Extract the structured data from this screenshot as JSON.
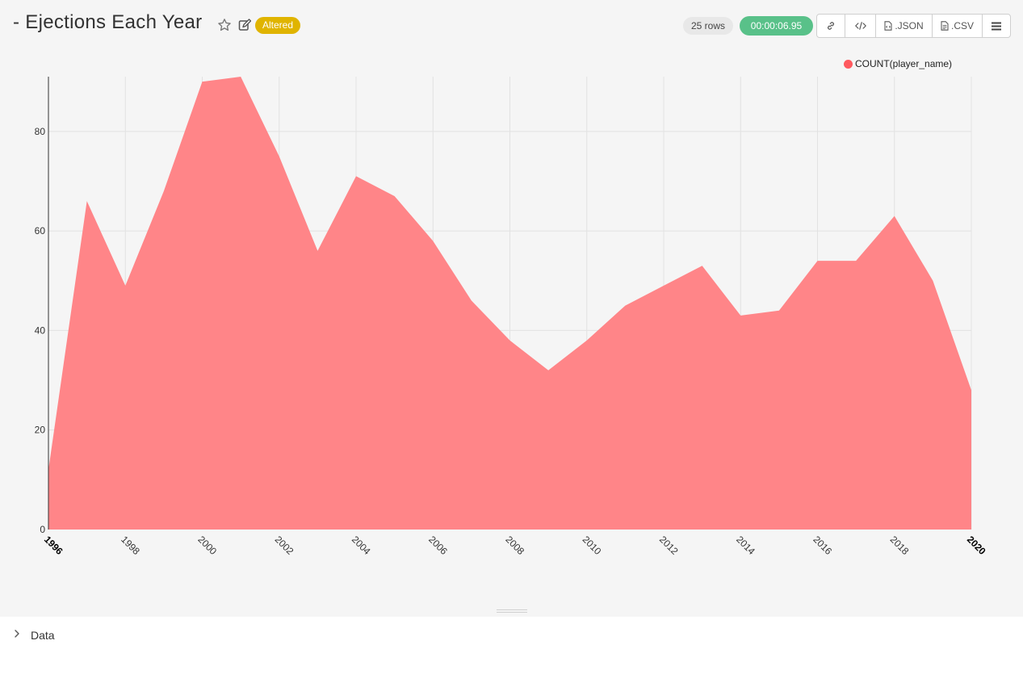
{
  "header": {
    "title": "- Ejections Each Year",
    "altered_badge": "Altered",
    "rows_badge": "25 rows",
    "timer": "00:00:06.95",
    "json_label": ".JSON",
    "csv_label": ".CSV"
  },
  "icons": {
    "favorite": "star-icon",
    "edit": "edit-icon",
    "share_link": "link-icon",
    "embed_code": "code-icon",
    "json_file": "file-code-icon",
    "csv_file": "file-text-icon",
    "menu": "menu-icon",
    "data_toggle": "chevron-right-icon"
  },
  "colors": {
    "area": "#ff8588",
    "legend_dot": "#ff5a5f",
    "altered": "#e0b400",
    "timer": "#59c189"
  },
  "data_panel": {
    "label": "Data"
  },
  "chart_data": {
    "type": "area",
    "series": [
      {
        "name": "COUNT(player_name)",
        "x": [
          1996,
          1997,
          1998,
          1999,
          2000,
          2001,
          2002,
          2003,
          2004,
          2005,
          2006,
          2007,
          2008,
          2009,
          2010,
          2011,
          2012,
          2013,
          2014,
          2015,
          2016,
          2017,
          2018,
          2019,
          2020
        ],
        "values": [
          12,
          66,
          49,
          68,
          90,
          91,
          75,
          56,
          71,
          67,
          58,
          46,
          38,
          32,
          38,
          45,
          49,
          53,
          43,
          44,
          54,
          54,
          63,
          50,
          28
        ]
      }
    ],
    "xlim": [
      1996,
      2020
    ],
    "ylim": [
      0,
      91
    ],
    "y_ticks": [
      0,
      20,
      40,
      60,
      80
    ],
    "x_ticks": [
      1996,
      1998,
      2000,
      2002,
      2004,
      2006,
      2008,
      2010,
      2012,
      2014,
      2016,
      2018,
      2020
    ],
    "x_ticks_bold": [
      1996,
      2020
    ],
    "grid": true,
    "legend_position": "top-right",
    "title": "",
    "xlabel": "",
    "ylabel": ""
  }
}
